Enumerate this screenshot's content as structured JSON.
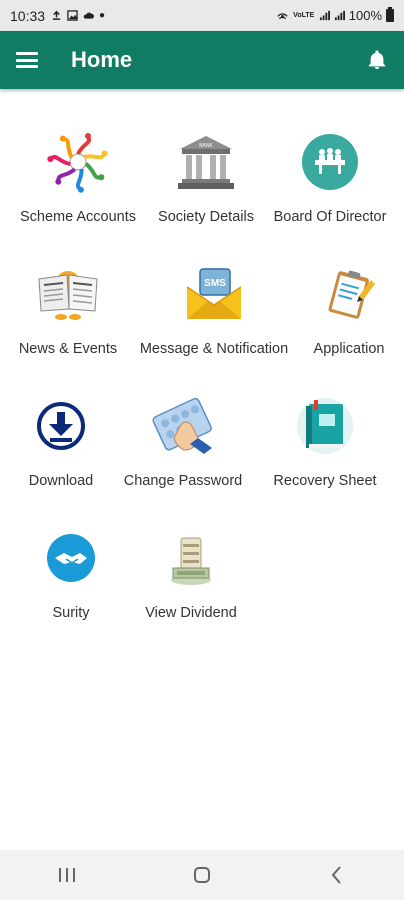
{
  "status_bar": {
    "time": "10:33",
    "network_text": "VoLTE",
    "battery": "100%"
  },
  "app_bar": {
    "title": "Home",
    "menu_icon": "hamburger-menu-icon",
    "bell_icon": "bell-icon"
  },
  "menu": {
    "items": [
      {
        "label": "Scheme Accounts",
        "icon": "scheme-accounts-icon"
      },
      {
        "label": "Society Details",
        "icon": "bank-building-icon"
      },
      {
        "label": "Board Of Director",
        "icon": "board-meeting-icon"
      },
      {
        "label": "News & Events",
        "icon": "newspaper-icon"
      },
      {
        "label": "Message & Notification",
        "icon": "sms-envelope-icon"
      },
      {
        "label": "Application",
        "icon": "clipboard-icon"
      },
      {
        "label": "Download",
        "icon": "download-icon"
      },
      {
        "label": "Change Password",
        "icon": "keypad-hand-icon"
      },
      {
        "label": "Recovery Sheet",
        "icon": "book-icon"
      },
      {
        "label": "Surity",
        "icon": "handshake-icon"
      },
      {
        "label": "View Dividend",
        "icon": "money-stack-icon"
      }
    ]
  },
  "colors": {
    "app_bar": "#0f7c63",
    "accent_blue": "#1a9ad6",
    "teal": "#3aa99f"
  },
  "nav_bar": {
    "recent": "recent-apps-icon",
    "home": "home-icon",
    "back": "back-icon"
  }
}
